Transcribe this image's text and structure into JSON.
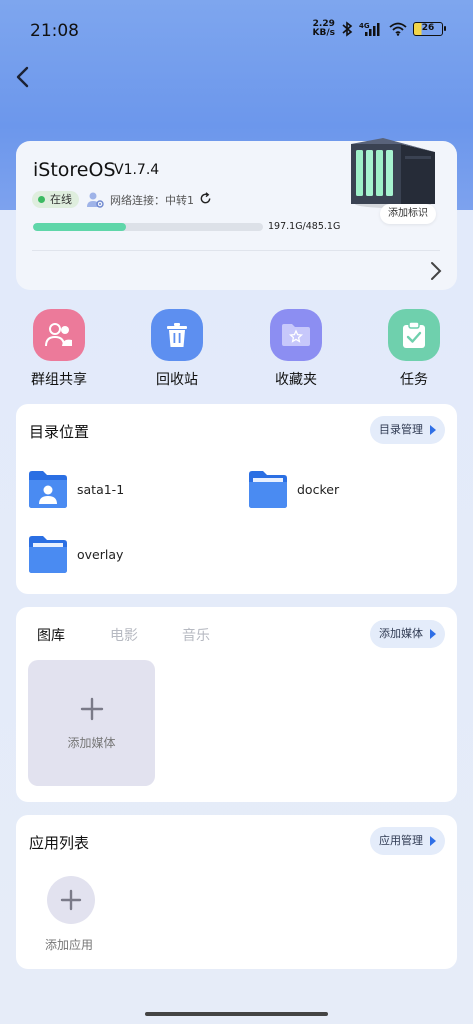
{
  "status_bar": {
    "time": "21:08",
    "net_speed_value": "2.29",
    "net_speed_unit": "KB/s",
    "signal_label": "4G",
    "battery": "26",
    "icons": [
      "bluetooth-icon",
      "signal-icon",
      "wifi-icon",
      "battery-icon"
    ]
  },
  "device": {
    "name": "iStoreOS",
    "version": "V1.7.4",
    "status": "在线",
    "network_label": "网络连接：中转1",
    "storage_text": "197.1G/485.1G",
    "storage_used_fraction": 0.406,
    "add_tag_label": "添加标识"
  },
  "quick_actions": [
    {
      "label": "群组共享",
      "icon": "group-share-icon",
      "color": "#ec7a9a"
    },
    {
      "label": "回收站",
      "icon": "trash-icon",
      "color": "#5d8ff0"
    },
    {
      "label": "收藏夹",
      "icon": "favorites-folder-icon",
      "color": "#8c8ef2"
    },
    {
      "label": "任务",
      "icon": "task-clipboard-icon",
      "color": "#6fd0ad"
    }
  ],
  "directories": {
    "title": "目录位置",
    "manage_label": "目录管理",
    "items": [
      {
        "label": "sata1-1",
        "icon": "user-folder-icon"
      },
      {
        "label": "docker",
        "icon": "folder-icon"
      },
      {
        "label": "overlay",
        "icon": "folder-icon"
      }
    ]
  },
  "media": {
    "tabs": [
      "图库",
      "电影",
      "音乐"
    ],
    "active_tab": "图库",
    "add_label": "添加媒体",
    "tile_label": "添加媒体"
  },
  "apps": {
    "title": "应用列表",
    "manage_label": "应用管理",
    "add_label": "添加应用"
  },
  "colors": {
    "header_blue": "#6c97ec",
    "storage_fill": "#5fd6a9",
    "online_green": "#3cba62",
    "folder_blue": "#3f83ee"
  }
}
